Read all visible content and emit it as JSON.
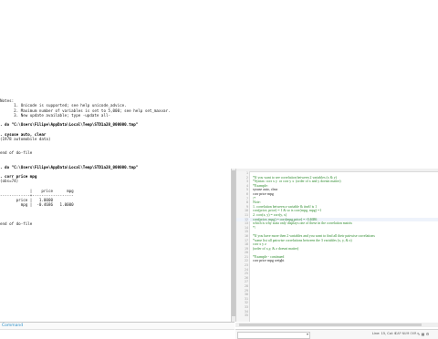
{
  "results": {
    "lines": [
      {
        "text": "",
        "cls": ""
      },
      {
        "text": "Notes:",
        "cls": ""
      },
      {
        "text": "      1. Unicode is supported; see help unicode_advice.",
        "cls": ""
      },
      {
        "text": "      2. Maximum number of variables is set to 5,000; see help set_maxvar.",
        "cls": ""
      },
      {
        "text": "      3. New update available; type -update all-",
        "cls": ""
      },
      {
        "text": "",
        "cls": ""
      },
      {
        "text": ". do \"C:\\Users\\Filipe\\AppData\\Local\\Temp\\STD1a28_000000.tmp\"",
        "cls": "cmd"
      },
      {
        "text": "",
        "cls": ""
      },
      {
        "text": ". sysuse auto, clear",
        "cls": "cmd"
      },
      {
        "text": "(1978 automobile data)",
        "cls": ""
      },
      {
        "text": "",
        "cls": ""
      },
      {
        "text": "",
        "cls": ""
      },
      {
        "text": "end of do-file",
        "cls": ""
      },
      {
        "text": "",
        "cls": ""
      },
      {
        "text": "",
        "cls": ""
      },
      {
        "text": ". do \"C:\\Users\\Filipe\\AppData\\Local\\Temp\\STD1a28_000000.tmp\"",
        "cls": "cmd"
      },
      {
        "text": "",
        "cls": ""
      },
      {
        "text": ". corr price mpg",
        "cls": "cmd"
      },
      {
        "text": "(obs=74)",
        "cls": ""
      },
      {
        "text": "",
        "cls": ""
      },
      {
        "text": "             |    price      mpg",
        "cls": ""
      },
      {
        "text": "-------------+------------------",
        "cls": ""
      },
      {
        "text": "       price |   1.0000",
        "cls": ""
      },
      {
        "text": "         mpg |  -0.4686   1.0000",
        "cls": ""
      },
      {
        "text": "",
        "cls": ""
      },
      {
        "text": "",
        "cls": ""
      },
      {
        "text": "",
        "cls": ""
      },
      {
        "text": "end of do-file",
        "cls": ""
      }
    ]
  },
  "command_bar": {
    "label": "Command"
  },
  "editor": {
    "rows": [
      {
        "num": "1",
        "code": "",
        "style": "green"
      },
      {
        "num": "2",
        "code": "*If you want to see correlation between 2 variables (x & y)",
        "style": "green"
      },
      {
        "num": "3",
        "code": "*Syntax: corr x y  or corr y x  (order of x and y doesnt matter)",
        "style": "green"
      },
      {
        "num": "4",
        "code": "*Example:",
        "style": "green"
      },
      {
        "num": "5",
        "code": "sysuse auto, clear",
        "style": "plain"
      },
      {
        "num": "6",
        "code": "corr price mpg",
        "style": "plain"
      },
      {
        "num": "7",
        "code": "/*",
        "style": "green"
      },
      {
        "num": "8",
        "code": "Note:",
        "style": "green"
      },
      {
        "num": "9",
        "code": "1. correlation between a variable & itself is 1",
        "style": "green"
      },
      {
        "num": "10",
        "code": "corr(price, price) = 1 & so is corr(mpg, mpg) =1",
        "style": "green"
      },
      {
        "num": "11",
        "code": "2. corr(x, y) = corr(y, x)",
        "style": "green"
      },
      {
        "num": "12",
        "code": "corr(price, mpg) = corr(mpg,price) = -0.4686",
        "style": "green",
        "hl": true
      },
      {
        "num": "13",
        "code": "which is why stata only displays one of these in the correlation matrix",
        "style": "green"
      },
      {
        "num": "14",
        "code": "*/",
        "style": "green"
      },
      {
        "num": "15",
        "code": "",
        "style": "green"
      },
      {
        "num": "16",
        "code": "*If you have more then 2 variables and you want to find all their pairwise correlations",
        "style": "green"
      },
      {
        "num": "17",
        "code": "*some list all pairwise correlations between the 3 variables (x, y, & z)",
        "style": "green"
      },
      {
        "num": "18",
        "code": "corr x y z",
        "style": "green"
      },
      {
        "num": "19",
        "code": "(order of x,y, & z doesnt matter)",
        "style": "green"
      },
      {
        "num": "20",
        "code": "",
        "style": "green"
      },
      {
        "num": "21",
        "code": "*Example - continued",
        "style": "green"
      },
      {
        "num": "22",
        "code": "corr price mpg weight",
        "style": "plain"
      },
      {
        "num": "23",
        "code": "",
        "style": "plain"
      },
      {
        "num": "24",
        "code": "",
        "style": "plain"
      },
      {
        "num": "25",
        "code": "",
        "style": "plain"
      },
      {
        "num": "26",
        "code": "",
        "style": "plain"
      },
      {
        "num": "27",
        "code": "",
        "style": "plain"
      },
      {
        "num": "28",
        "code": "",
        "style": "plain"
      },
      {
        "num": "29",
        "code": "",
        "style": "plain"
      },
      {
        "num": "30",
        "code": "",
        "style": "plain"
      },
      {
        "num": "31",
        "code": "",
        "style": "plain"
      },
      {
        "num": "32",
        "code": "",
        "style": "plain"
      },
      {
        "num": "33",
        "code": "",
        "style": "plain"
      },
      {
        "num": "34",
        "code": "",
        "style": "plain"
      },
      {
        "num": "35",
        "code": "",
        "style": "plain"
      }
    ]
  },
  "status": {
    "position": "Line: 15, Col: 0",
    "badges": "CAP  NUM  OVR"
  },
  "colors": {
    "comment_green": "#2e8b2e",
    "command_blue": "#2a8fc9"
  }
}
